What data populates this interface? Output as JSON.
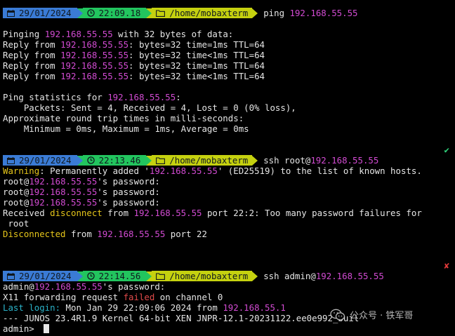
{
  "colors": {
    "background": "#000000",
    "text": "#e6e6e6",
    "ip": "#d24bd2",
    "warning": "#e5c51a",
    "error": "#e24a4a",
    "info": "#2bb3c9",
    "seg_date": "#3a7bd5",
    "seg_time": "#22c55e",
    "seg_path": "#c5d10f",
    "ok": "#2fd07a"
  },
  "prompts": [
    {
      "date": "29/01/2024",
      "time": "22:09.18",
      "path": "/home/mobaxterm",
      "cmd": "ping ",
      "cmd_ip": "192.168.55.55",
      "cmd_tail": ""
    },
    {
      "date": "29/01/2024",
      "time": "22:13.46",
      "path": "/home/mobaxterm",
      "cmd": "ssh root@",
      "cmd_ip": "192.168.55.55",
      "cmd_tail": ""
    },
    {
      "date": "29/01/2024",
      "time": "22:14.56",
      "path": "/home/mobaxterm",
      "cmd": "ssh admin@",
      "cmd_ip": "192.168.55.55",
      "cmd_tail": ""
    }
  ],
  "ping": {
    "head_a": "Pinging ",
    "ip": "192.168.55.55",
    "head_b": " with 32 bytes of data:",
    "replies": [
      {
        "a": "Reply from ",
        "ip": "192.168.55.55",
        "b": ": bytes=32 time=1ms TTL=64"
      },
      {
        "a": "Reply from ",
        "ip": "192.168.55.55",
        "b": ": bytes=32 time<1ms TTL=64"
      },
      {
        "a": "Reply from ",
        "ip": "192.168.55.55",
        "b": ": bytes=32 time=1ms TTL=64"
      },
      {
        "a": "Reply from ",
        "ip": "192.168.55.55",
        "b": ": bytes=32 time<1ms TTL=64"
      }
    ],
    "stats_a": "Ping statistics for ",
    "stats_b": ":",
    "packets": "    Packets: Sent = 4, Received = 4, Lost = 0 (0% loss),",
    "approx": "Approximate round trip times in milli-seconds:",
    "minmax": "    Minimum = 0ms, Maximum = 1ms, Average = 0ms",
    "status_icon": "check-icon"
  },
  "ssh_root": {
    "warn_word": "Warning",
    "warn_a": ": Permanently added '",
    "warn_ip": "192.168.55.55",
    "warn_b": "' (ED25519) to the list of known hosts.",
    "pw_prefix": "root@",
    "pw_suffix": "'s password:",
    "received_a": "Received ",
    "disconnect_word": "disconnect",
    "received_b": " from ",
    "received_c": " port 22:2: Too many password failures for",
    "received_d": " root",
    "disconnected_word": "Disconnected",
    "disconnected_b": " from ",
    "disconnected_c": " port 22",
    "status_icon": "cross-icon"
  },
  "ssh_admin": {
    "pw_prefix": "admin@",
    "pw_suffix": "'s password:",
    "x11_a": "X11 forwarding request ",
    "x11_failed": "failed",
    "x11_b": " on channel 0",
    "last_login_label": "Last login:",
    "last_login_text": " Mon Jan 29 22:09:06 2024 from ",
    "last_login_ip": "192.168.55.1",
    "junos": "--- JUNOS 23.4R1.9 Kernel 64-bit XEN JNPR-12.1-20231122.ee0e992_buil",
    "cli_prompt": "admin> "
  },
  "watermark": {
    "text": "公众号 · 铁军哥",
    "icon": "wechat-logo-icon"
  }
}
